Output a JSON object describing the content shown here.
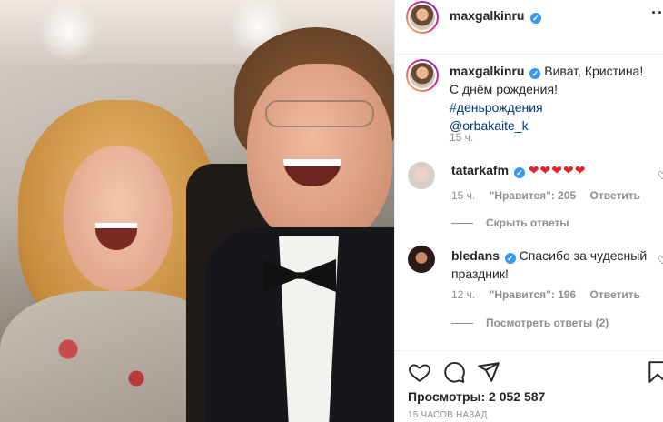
{
  "post": {
    "author": "maxgalkinru",
    "verified_glyph": "✓",
    "more_glyph": "···"
  },
  "caption": {
    "username": "maxgalkinru",
    "text": "Виват, Кристина! С днём рождения!",
    "hashtag": "#деньрождения",
    "mention": "@orbakaite_k",
    "time": "15 ч."
  },
  "comments": [
    {
      "username": "tatarkafm",
      "text": "❤❤❤❤❤",
      "time": "15 ч.",
      "likes": "\"Нравится\": 205",
      "reply_label": "Ответить",
      "replies_label": "Скрыть ответы"
    },
    {
      "username": "bledans",
      "text": "Спасибо за чудесный праздник!",
      "time": "12 ч.",
      "likes": "\"Нравится\": 196",
      "reply_label": "Ответить",
      "replies_label": "Посмотреть ответы (2)"
    }
  ],
  "footer": {
    "views": "Просмотры: 2 052 587",
    "posted": "15 ЧАСОВ НАЗАД"
  },
  "icons": {
    "like": "heart-icon",
    "comment": "comment-icon",
    "share": "share-icon",
    "save": "bookmark-icon",
    "comment_like": "heart-outline-icon"
  },
  "colors": {
    "verified": "#3897f0",
    "link": "#00376b",
    "hearts": "#e0242b",
    "secondary_text": "#8e8e8e"
  }
}
